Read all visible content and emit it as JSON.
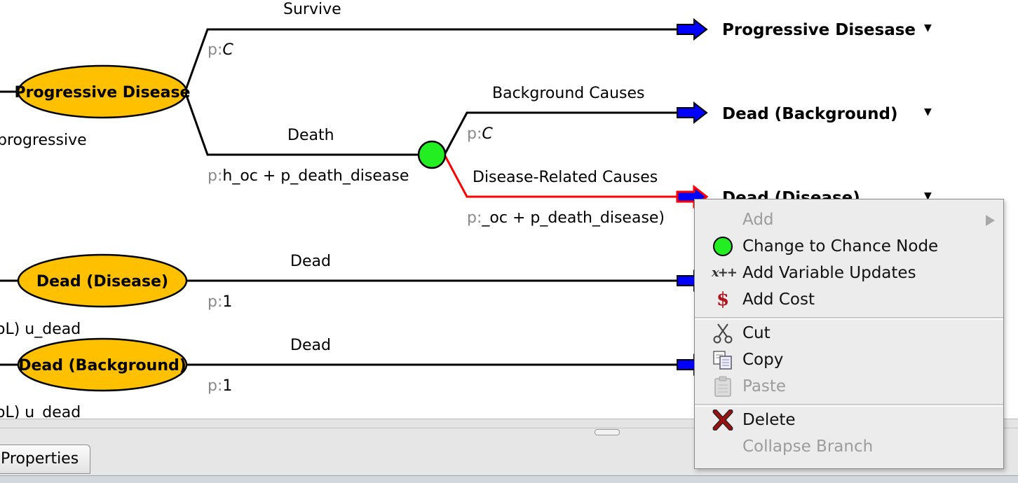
{
  "tree": {
    "nodes": {
      "progressive": "Progressive Disease",
      "dead_disease": "Dead (Disease)",
      "dead_background": "Dead (Background)"
    },
    "branches": {
      "survive": {
        "label": "Survive",
        "prob_prefix": "p:",
        "prob": "C"
      },
      "death": {
        "label": "Death",
        "prob_prefix": "p:",
        "prob": "h_oc + p_death_disease"
      },
      "background": {
        "label": "Background Causes",
        "prob_prefix": "p:",
        "prob": "C"
      },
      "disease_related": {
        "label": "Disease-Related Causes",
        "prob_prefix": "p:",
        "prob": "_oc + p_death_disease)"
      },
      "dead_disease": {
        "label": "Dead",
        "prob_prefix": "p:",
        "prob": "1"
      },
      "dead_background": {
        "label": "Dead",
        "prob_prefix": "p:",
        "prob": "1"
      }
    },
    "terminals": {
      "progressive": "Progressive Disesase",
      "dead_background": "Dead (Background)",
      "dead_disease": "Dead (Disease)"
    },
    "left_labels": {
      "progressive": "progressive",
      "dead_disease_utility": "oL) u_dead",
      "dead_background_utility": "oL) u_dead"
    },
    "colors": {
      "state_node": "#ffc000",
      "chance_node": "#22ee22",
      "selected_branch": "#ff0000",
      "terminal_arrow": "#0000ff"
    }
  },
  "context_menu": {
    "items": [
      {
        "label": "Add",
        "icon": "none",
        "disabled": true,
        "submenu": true
      },
      {
        "label": "Change to Chance Node",
        "icon": "chance-node-icon",
        "disabled": false
      },
      {
        "label": "Add Variable Updates",
        "icon": "variable-update-icon",
        "disabled": false
      },
      {
        "label": "Add Cost",
        "icon": "dollar-icon",
        "disabled": false
      },
      {
        "label": "Cut",
        "icon": "scissors-icon",
        "disabled": false
      },
      {
        "label": "Copy",
        "icon": "copy-icon",
        "disabled": false
      },
      {
        "label": "Paste",
        "icon": "clipboard-icon",
        "disabled": true
      },
      {
        "label": "Delete",
        "icon": "delete-x-icon",
        "disabled": false
      },
      {
        "label": "Collapse Branch",
        "icon": "none",
        "disabled": true
      }
    ],
    "icon_glyphs": {
      "variable_update": "x++",
      "dollar": "$"
    }
  },
  "bottom_panel": {
    "properties_tab": "Properties"
  }
}
